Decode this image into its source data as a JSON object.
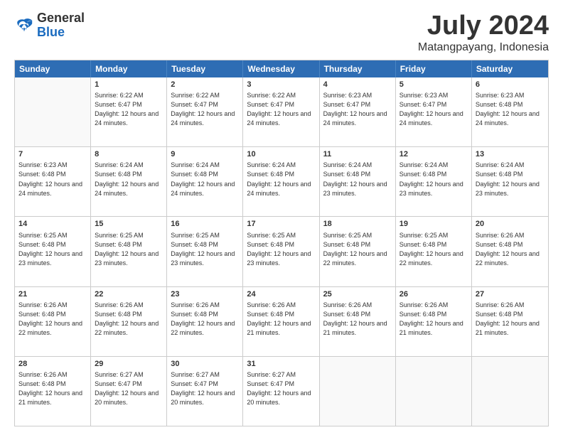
{
  "logo": {
    "general": "General",
    "blue": "Blue"
  },
  "title": {
    "month_year": "July 2024",
    "location": "Matangpayang, Indonesia"
  },
  "weekdays": [
    "Sunday",
    "Monday",
    "Tuesday",
    "Wednesday",
    "Thursday",
    "Friday",
    "Saturday"
  ],
  "weeks": [
    [
      {
        "day": "",
        "sunrise": "",
        "sunset": "",
        "daylight": ""
      },
      {
        "day": "1",
        "sunrise": "Sunrise: 6:22 AM",
        "sunset": "Sunset: 6:47 PM",
        "daylight": "Daylight: 12 hours and 24 minutes."
      },
      {
        "day": "2",
        "sunrise": "Sunrise: 6:22 AM",
        "sunset": "Sunset: 6:47 PM",
        "daylight": "Daylight: 12 hours and 24 minutes."
      },
      {
        "day": "3",
        "sunrise": "Sunrise: 6:22 AM",
        "sunset": "Sunset: 6:47 PM",
        "daylight": "Daylight: 12 hours and 24 minutes."
      },
      {
        "day": "4",
        "sunrise": "Sunrise: 6:23 AM",
        "sunset": "Sunset: 6:47 PM",
        "daylight": "Daylight: 12 hours and 24 minutes."
      },
      {
        "day": "5",
        "sunrise": "Sunrise: 6:23 AM",
        "sunset": "Sunset: 6:47 PM",
        "daylight": "Daylight: 12 hours and 24 minutes."
      },
      {
        "day": "6",
        "sunrise": "Sunrise: 6:23 AM",
        "sunset": "Sunset: 6:48 PM",
        "daylight": "Daylight: 12 hours and 24 minutes."
      }
    ],
    [
      {
        "day": "7",
        "sunrise": "Sunrise: 6:23 AM",
        "sunset": "Sunset: 6:48 PM",
        "daylight": "Daylight: 12 hours and 24 minutes."
      },
      {
        "day": "8",
        "sunrise": "Sunrise: 6:24 AM",
        "sunset": "Sunset: 6:48 PM",
        "daylight": "Daylight: 12 hours and 24 minutes."
      },
      {
        "day": "9",
        "sunrise": "Sunrise: 6:24 AM",
        "sunset": "Sunset: 6:48 PM",
        "daylight": "Daylight: 12 hours and 24 minutes."
      },
      {
        "day": "10",
        "sunrise": "Sunrise: 6:24 AM",
        "sunset": "Sunset: 6:48 PM",
        "daylight": "Daylight: 12 hours and 24 minutes."
      },
      {
        "day": "11",
        "sunrise": "Sunrise: 6:24 AM",
        "sunset": "Sunset: 6:48 PM",
        "daylight": "Daylight: 12 hours and 23 minutes."
      },
      {
        "day": "12",
        "sunrise": "Sunrise: 6:24 AM",
        "sunset": "Sunset: 6:48 PM",
        "daylight": "Daylight: 12 hours and 23 minutes."
      },
      {
        "day": "13",
        "sunrise": "Sunrise: 6:24 AM",
        "sunset": "Sunset: 6:48 PM",
        "daylight": "Daylight: 12 hours and 23 minutes."
      }
    ],
    [
      {
        "day": "14",
        "sunrise": "Sunrise: 6:25 AM",
        "sunset": "Sunset: 6:48 PM",
        "daylight": "Daylight: 12 hours and 23 minutes."
      },
      {
        "day": "15",
        "sunrise": "Sunrise: 6:25 AM",
        "sunset": "Sunset: 6:48 PM",
        "daylight": "Daylight: 12 hours and 23 minutes."
      },
      {
        "day": "16",
        "sunrise": "Sunrise: 6:25 AM",
        "sunset": "Sunset: 6:48 PM",
        "daylight": "Daylight: 12 hours and 23 minutes."
      },
      {
        "day": "17",
        "sunrise": "Sunrise: 6:25 AM",
        "sunset": "Sunset: 6:48 PM",
        "daylight": "Daylight: 12 hours and 23 minutes."
      },
      {
        "day": "18",
        "sunrise": "Sunrise: 6:25 AM",
        "sunset": "Sunset: 6:48 PM",
        "daylight": "Daylight: 12 hours and 22 minutes."
      },
      {
        "day": "19",
        "sunrise": "Sunrise: 6:25 AM",
        "sunset": "Sunset: 6:48 PM",
        "daylight": "Daylight: 12 hours and 22 minutes."
      },
      {
        "day": "20",
        "sunrise": "Sunrise: 6:26 AM",
        "sunset": "Sunset: 6:48 PM",
        "daylight": "Daylight: 12 hours and 22 minutes."
      }
    ],
    [
      {
        "day": "21",
        "sunrise": "Sunrise: 6:26 AM",
        "sunset": "Sunset: 6:48 PM",
        "daylight": "Daylight: 12 hours and 22 minutes."
      },
      {
        "day": "22",
        "sunrise": "Sunrise: 6:26 AM",
        "sunset": "Sunset: 6:48 PM",
        "daylight": "Daylight: 12 hours and 22 minutes."
      },
      {
        "day": "23",
        "sunrise": "Sunrise: 6:26 AM",
        "sunset": "Sunset: 6:48 PM",
        "daylight": "Daylight: 12 hours and 22 minutes."
      },
      {
        "day": "24",
        "sunrise": "Sunrise: 6:26 AM",
        "sunset": "Sunset: 6:48 PM",
        "daylight": "Daylight: 12 hours and 21 minutes."
      },
      {
        "day": "25",
        "sunrise": "Sunrise: 6:26 AM",
        "sunset": "Sunset: 6:48 PM",
        "daylight": "Daylight: 12 hours and 21 minutes."
      },
      {
        "day": "26",
        "sunrise": "Sunrise: 6:26 AM",
        "sunset": "Sunset: 6:48 PM",
        "daylight": "Daylight: 12 hours and 21 minutes."
      },
      {
        "day": "27",
        "sunrise": "Sunrise: 6:26 AM",
        "sunset": "Sunset: 6:48 PM",
        "daylight": "Daylight: 12 hours and 21 minutes."
      }
    ],
    [
      {
        "day": "28",
        "sunrise": "Sunrise: 6:26 AM",
        "sunset": "Sunset: 6:48 PM",
        "daylight": "Daylight: 12 hours and 21 minutes."
      },
      {
        "day": "29",
        "sunrise": "Sunrise: 6:27 AM",
        "sunset": "Sunset: 6:47 PM",
        "daylight": "Daylight: 12 hours and 20 minutes."
      },
      {
        "day": "30",
        "sunrise": "Sunrise: 6:27 AM",
        "sunset": "Sunset: 6:47 PM",
        "daylight": "Daylight: 12 hours and 20 minutes."
      },
      {
        "day": "31",
        "sunrise": "Sunrise: 6:27 AM",
        "sunset": "Sunset: 6:47 PM",
        "daylight": "Daylight: 12 hours and 20 minutes."
      },
      {
        "day": "",
        "sunrise": "",
        "sunset": "",
        "daylight": ""
      },
      {
        "day": "",
        "sunrise": "",
        "sunset": "",
        "daylight": ""
      },
      {
        "day": "",
        "sunrise": "",
        "sunset": "",
        "daylight": ""
      }
    ]
  ]
}
